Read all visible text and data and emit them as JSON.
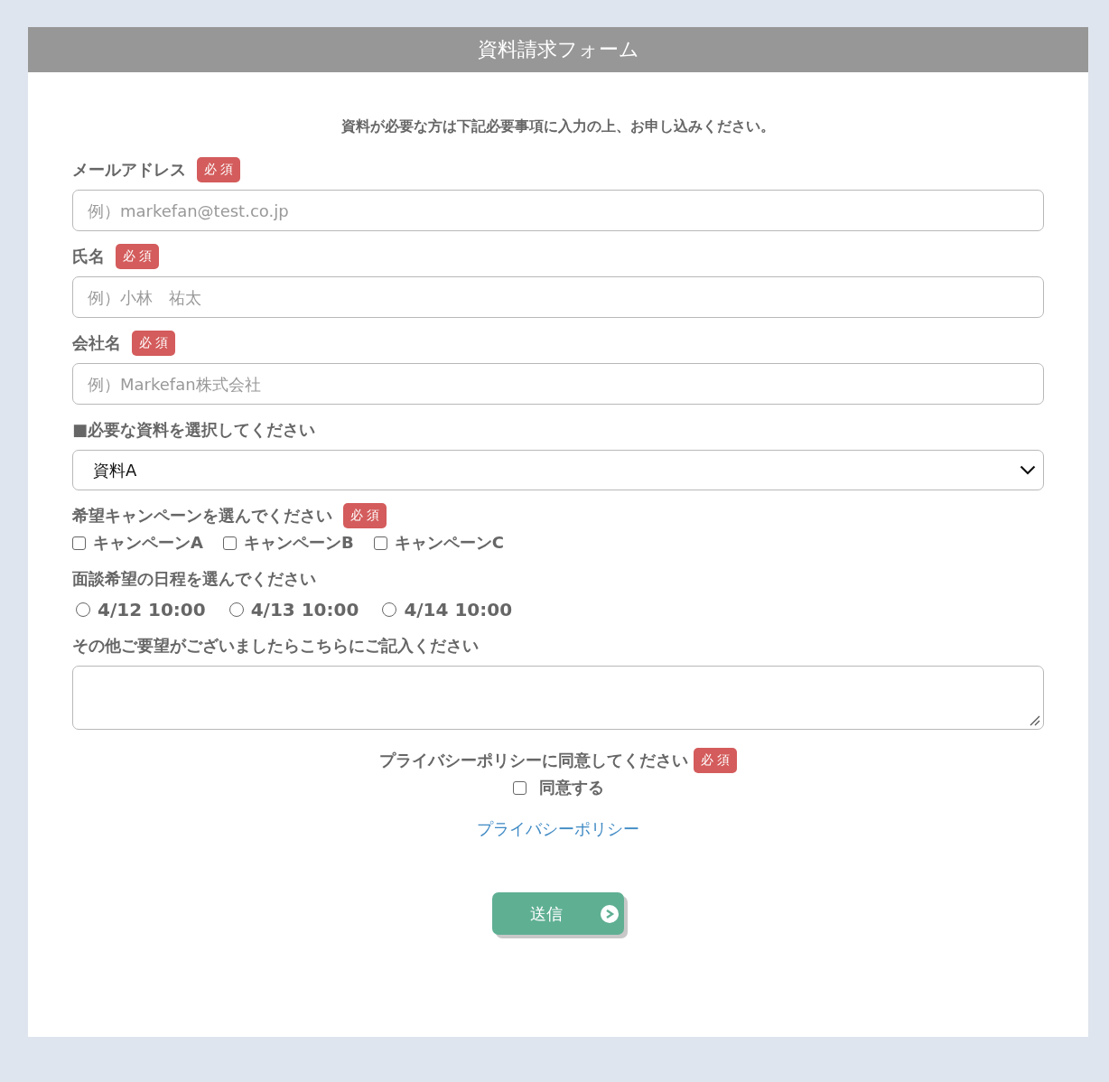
{
  "form": {
    "title": "資料請求フォーム",
    "intro": "資料が必要な方は下記必要事項に入力の上、お申し込みください。",
    "fields": [
      {
        "kind": "text",
        "label": "メールアドレス",
        "badge": "必 須",
        "placeholder": "例）markefan@test.co.jp"
      },
      {
        "kind": "text",
        "label": "氏名",
        "badge": "必 須",
        "placeholder": "例）小林　祐太"
      },
      {
        "kind": "text",
        "label": "会社名",
        "badge": "必 須",
        "placeholder": "例）Markefan株式会社"
      },
      {
        "kind": "select",
        "label": "■必要な資料を選択してください",
        "value": "資料A"
      },
      {
        "kind": "checkboxes",
        "label": "希望キャンペーンを選んでください",
        "badge": "必 須",
        "options": [
          {
            "label": "キャンペーンA",
            "checked": false
          },
          {
            "label": "キャンペーンB",
            "checked": false
          },
          {
            "label": "キャンペーンC",
            "checked": false
          }
        ]
      },
      {
        "kind": "radios",
        "label": "面談希望の日程を選んでください",
        "options": [
          {
            "label": "4/12 10:00",
            "selected": false
          },
          {
            "label": "4/13 10:00",
            "selected": false
          },
          {
            "label": "4/14 10:00",
            "selected": false
          }
        ]
      },
      {
        "kind": "textarea",
        "label": "その他ご要望がございましたらこちらにご記入ください"
      }
    ],
    "consent": {
      "label": "プライバシーポリシーに同意してください",
      "badge": "必 須",
      "checkbox_label": "同意する",
      "checked": false
    },
    "policy_link": "プライバシーポリシー",
    "submit": "送信"
  }
}
